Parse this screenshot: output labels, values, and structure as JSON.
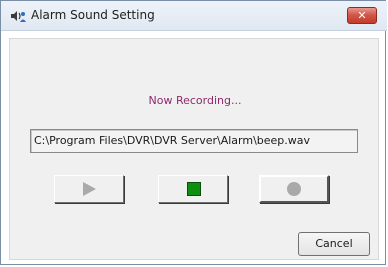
{
  "window": {
    "title": "Alarm Sound Setting",
    "title_icon": "speaker-person-icon",
    "close_glyph": "✕",
    "close_color": "#c9463a"
  },
  "dialog": {
    "status_text": "Now Recording...",
    "status_color": "#8e2a6b",
    "file_path": "C:\\Program Files\\DVR\\DVR Server\\Alarm\\beep.wav",
    "buttons": {
      "play_icon": "play-icon",
      "stop_icon": "stop-icon",
      "record_icon": "record-icon",
      "stop_color": "#0f8f0f",
      "cancel_label": "Cancel"
    }
  }
}
